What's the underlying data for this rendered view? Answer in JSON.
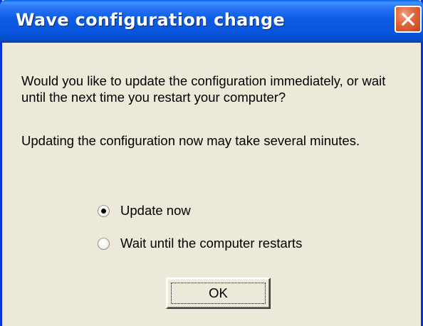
{
  "window": {
    "title": "Wave configuration change"
  },
  "message": {
    "question": "Would you like to update the configuration immediately, or wait until the next time you restart your computer?",
    "note": "Updating the configuration now may take several minutes."
  },
  "options": [
    {
      "label": "Update now",
      "selected": true
    },
    {
      "label": "Wait until the computer restarts",
      "selected": false
    }
  ],
  "buttons": {
    "ok_label": "OK"
  },
  "icons": {
    "close": "close-icon",
    "radio": "radio-button"
  },
  "colors": {
    "titlebar": "#0A56DE",
    "dialog_background": "#ECE9D8",
    "close_button": "#D9582E",
    "title_text": "#FFFFFF"
  }
}
